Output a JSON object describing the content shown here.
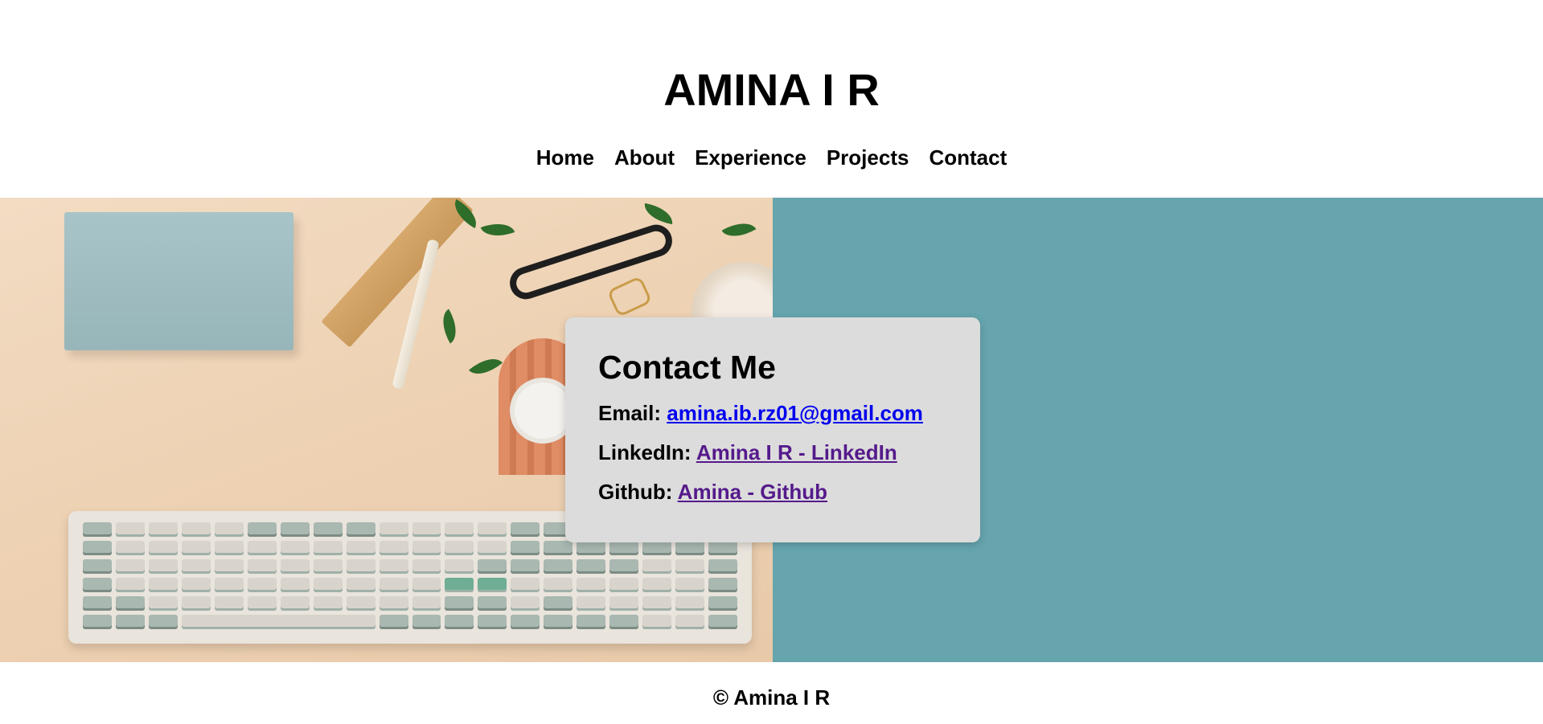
{
  "header": {
    "title": "AMINA I R",
    "nav": [
      {
        "label": "Home"
      },
      {
        "label": "About"
      },
      {
        "label": "Experience"
      },
      {
        "label": "Projects"
      },
      {
        "label": "Contact"
      }
    ]
  },
  "hero": {
    "image_icon": "desk-workspace-photo",
    "right_panel_color": "#66a5ae"
  },
  "contact": {
    "heading": "Contact Me",
    "email_label": "Email:",
    "email_value": "amina.ib.rz01@gmail.com",
    "linkedin_label": "LinkedIn:",
    "linkedin_value": "Amina I R - LinkedIn",
    "github_label": "Github:",
    "github_value": "Amina - Github"
  },
  "footer": {
    "text": "© Amina I R"
  },
  "colors": {
    "link_unvisited": "#0000ee",
    "link_visited": "#551a8b",
    "card_background": "#dcdcdc",
    "teal_panel": "#66a5ae"
  }
}
